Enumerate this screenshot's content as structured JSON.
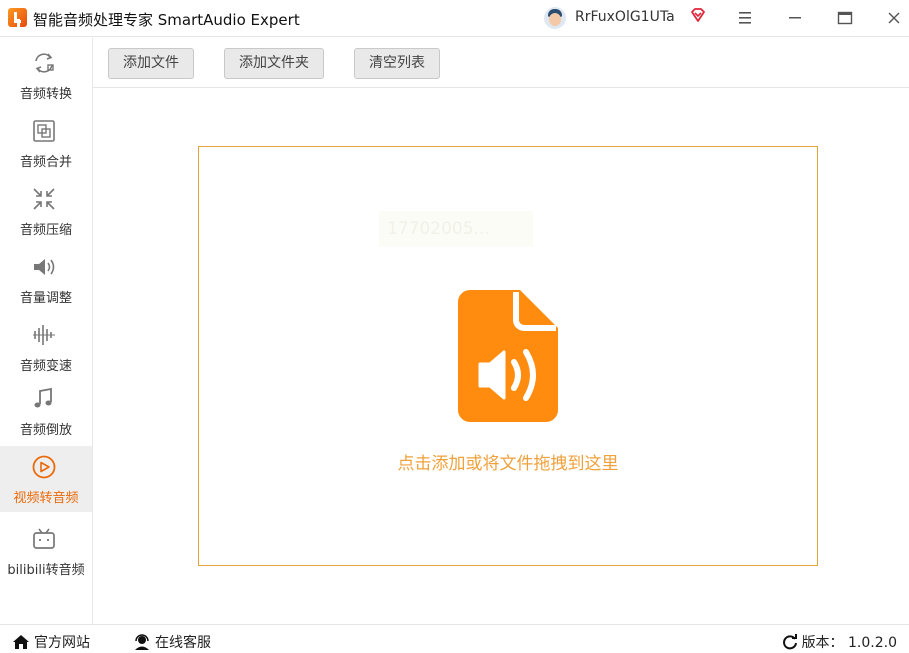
{
  "window": {
    "title": "智能音频处理专家 SmartAudio Expert",
    "username": "RrFuxOlG1UTa"
  },
  "sidebar": {
    "items": [
      {
        "label": "音频转换",
        "icon": "convert-icon"
      },
      {
        "label": "音频合并",
        "icon": "merge-icon"
      },
      {
        "label": "音频压缩",
        "icon": "compress-icon"
      },
      {
        "label": "音量调整",
        "icon": "volume-icon"
      },
      {
        "label": "音频变速",
        "icon": "speed-icon"
      },
      {
        "label": "音频倒放",
        "icon": "music-note-icon"
      },
      {
        "label": "视频转音频",
        "icon": "video-play-icon",
        "active": true
      },
      {
        "label": "bilibili转音频",
        "icon": "bilibili-tv-icon"
      }
    ]
  },
  "toolbar": {
    "add_file": "添加文件",
    "add_folder": "添加文件夹",
    "clear_list": "清空列表"
  },
  "dropzone": {
    "watermark": "17702005...",
    "hint": "点击添加或将文件拖拽到这里"
  },
  "footer": {
    "website": "官方网站",
    "support": "在线客服",
    "version": "版本： 1.0.2.0"
  },
  "colors": {
    "accent": "#ea6b0b",
    "icon_orange": "#ff8c0f",
    "dropzone_border": "#e6a23c",
    "hint_text": "#f0a13b"
  }
}
